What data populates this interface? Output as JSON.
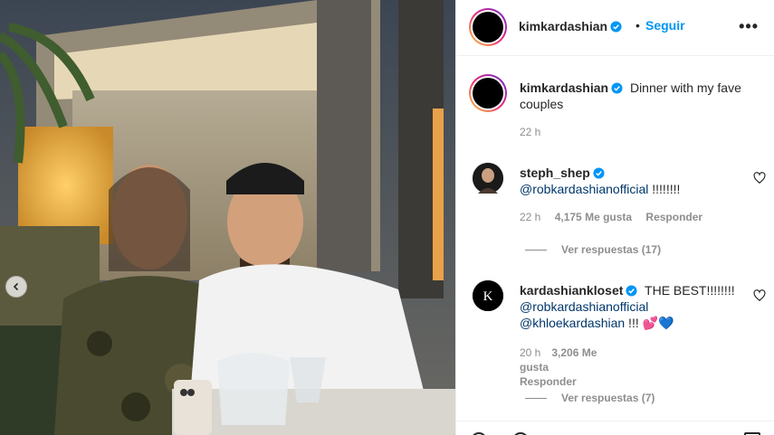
{
  "post": {
    "author": "kimkardashian",
    "follow_label": "Seguir",
    "separator": "•",
    "more_icon": "more-icon",
    "caption": "Dinner with my fave couples",
    "caption_time": "22 h"
  },
  "comments": [
    {
      "user": "steph_shep",
      "mention": "@robkardashianofficial",
      "text_after": " !!!!!!!!",
      "time": "22 h",
      "likes": "4,175 Me gusta",
      "reply_label": "Responder",
      "view_replies": "Ver respuestas (17)"
    },
    {
      "user": "kardashiankloset",
      "text_before": "THE BEST!!!!!!!! ",
      "mention": "@robkardashianofficial",
      "mention2": "@khloekardashian",
      "text_after": " !!! 💕💙",
      "time": "20 h",
      "likes": "3,206 Me gusta",
      "reply_label": "Responder",
      "view_replies": "Ver respuestas (7)"
    }
  ],
  "colors": {
    "link": "#00376b",
    "follow": "#0095f6",
    "verified": "#0095f6",
    "meta": "#8e8e8e"
  }
}
